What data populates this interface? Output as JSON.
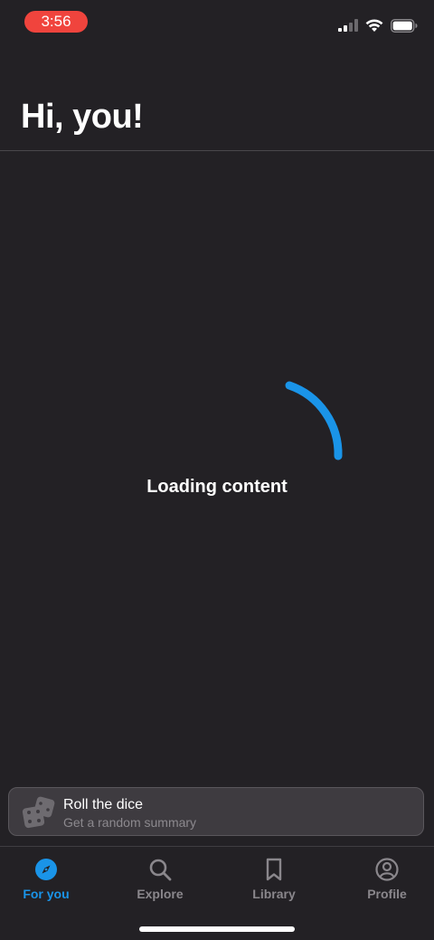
{
  "status_bar": {
    "time": "3:56",
    "icons": [
      "cellular-signal-icon",
      "wifi-icon",
      "battery-icon"
    ]
  },
  "header": {
    "title": "Hi, you!"
  },
  "loading": {
    "text": "Loading content",
    "spinner_color": "#1a94e8"
  },
  "dice_card": {
    "icon": "dice-icon",
    "title": "Roll the dice",
    "subtitle": "Get a random summary"
  },
  "tab_bar": {
    "active_color": "#1a94e8",
    "tabs": [
      {
        "label": "For you",
        "icon": "compass-icon",
        "active": true
      },
      {
        "label": "Explore",
        "icon": "search-icon",
        "active": false
      },
      {
        "label": "Library",
        "icon": "bookmark-icon",
        "active": false
      },
      {
        "label": "Profile",
        "icon": "profile-icon",
        "active": false
      }
    ]
  }
}
